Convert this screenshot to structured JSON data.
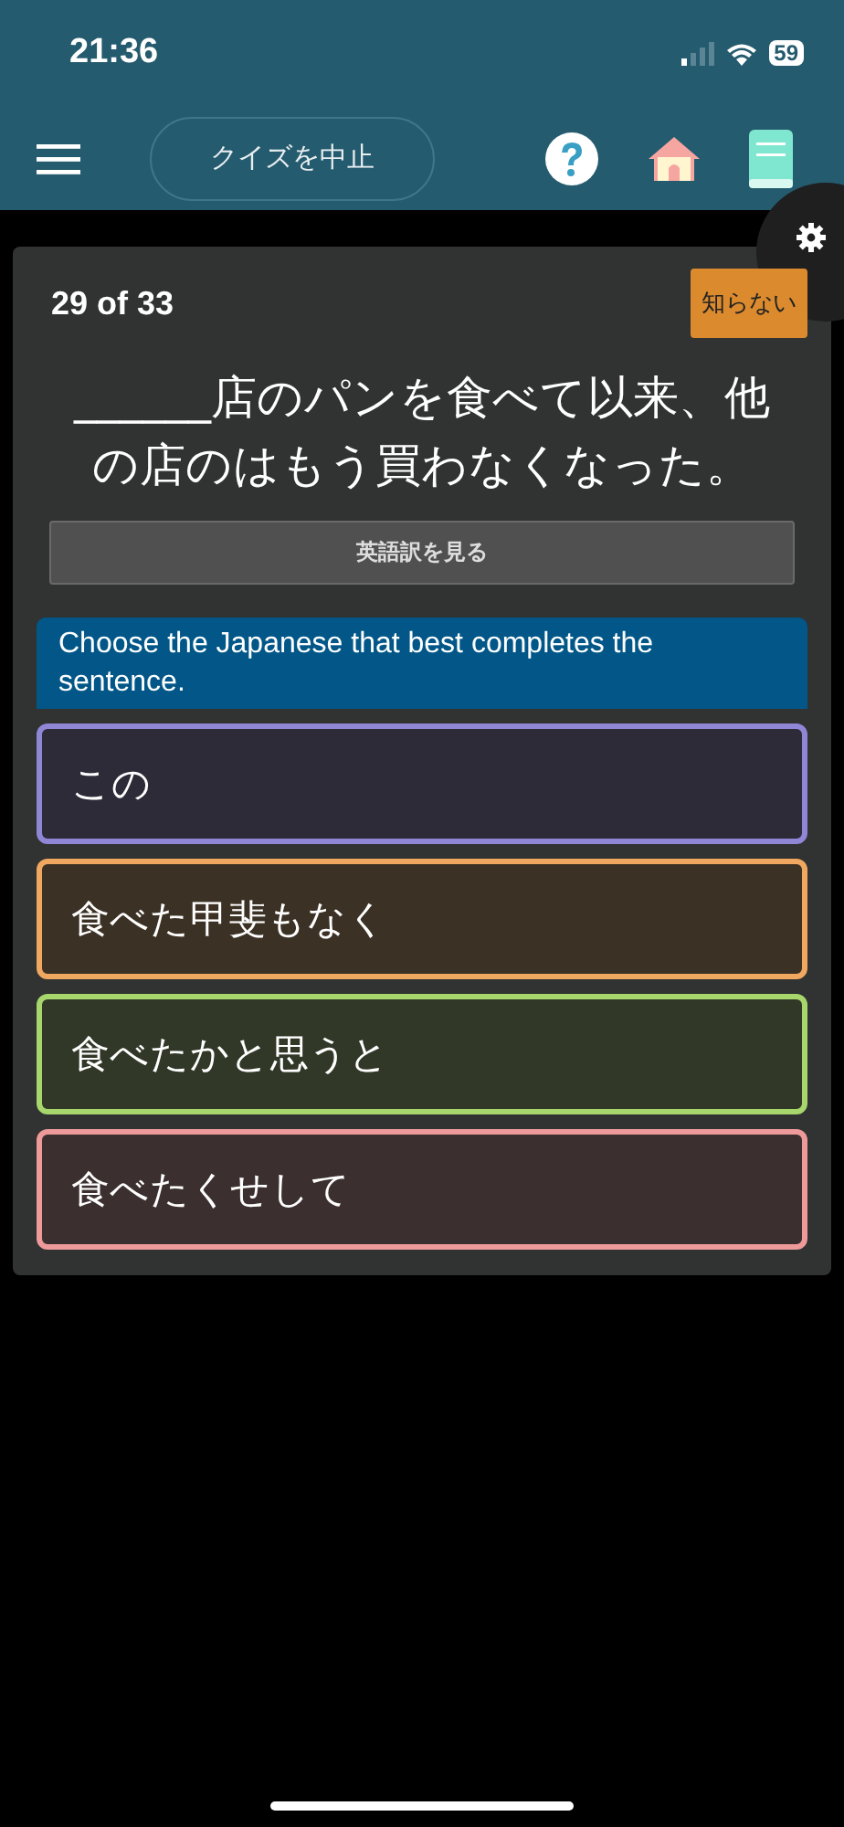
{
  "status_bar": {
    "time": "21:36",
    "battery": "59"
  },
  "header": {
    "stop_button": "クイズを中止"
  },
  "card": {
    "progress": "29 of 33",
    "dont_know_button": "知らない",
    "question": "______店のパンを食べて以来、他の店のはもう買わなくなった。",
    "translation_button": "英語訳を見る",
    "instruction": "Choose the Japanese that best completes the sentence.",
    "options": [
      {
        "text": "この",
        "color": "#8f86d6"
      },
      {
        "text": "食べた甲斐もなく",
        "color": "#f0a860"
      },
      {
        "text": "食べたかと思うと",
        "color": "#a6d66c"
      },
      {
        "text": "食べたくせして",
        "color": "#ee9a9a"
      }
    ]
  }
}
